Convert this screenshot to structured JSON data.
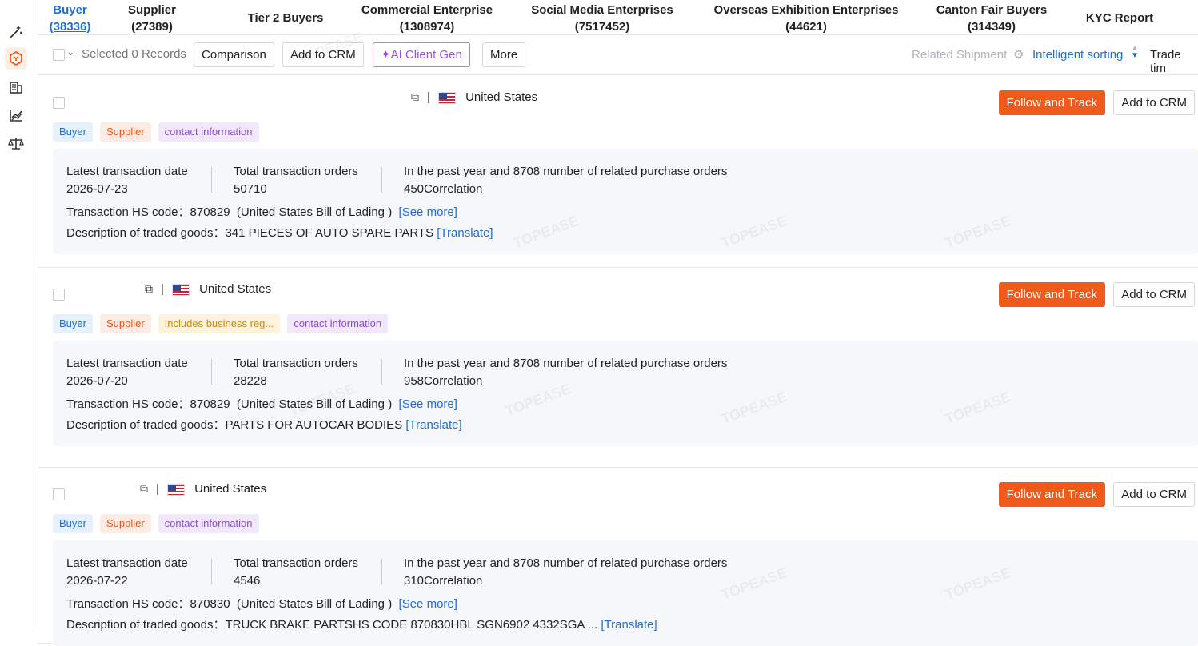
{
  "tabs": [
    {
      "label": "Buyer",
      "count": "(38336)",
      "active": true
    },
    {
      "label": "Supplier",
      "count": "(27389)"
    },
    {
      "label": "Tier 2 Buyers",
      "count": ""
    },
    {
      "label": "Commercial Enterprise",
      "count": "(1308974)"
    },
    {
      "label": "Social Media Enterprises",
      "count": "(7517452)"
    },
    {
      "label": "Overseas Exhibition Enterprises",
      "count": "(44621)"
    },
    {
      "label": "Canton Fair Buyers",
      "count": "(314349)"
    },
    {
      "label": "KYC Report",
      "count": ""
    }
  ],
  "toolbar": {
    "selected": "Selected 0 Records",
    "comparison": "Comparison",
    "add_crm": "Add to CRM",
    "ai_client_gen": "AI Client Gen",
    "more": "More",
    "related_shipment": "Related Shipment",
    "intelligent_sorting": "Intelligent sorting",
    "trade_time": "Trade tim"
  },
  "card_labels": {
    "follow": "Follow and Track",
    "add_crm": "Add to CRM",
    "latest_date": "Latest transaction date",
    "total_orders": "Total transaction orders",
    "related": "In the past year and 8708 number of related purchase orders",
    "hs_prefix": "Transaction HS code：",
    "see_more": "[See more]",
    "desc_prefix": "Description of traded goods：",
    "translate": "[Translate]"
  },
  "records": [
    {
      "country": "United States",
      "tags": [
        "Buyer",
        "Supplier",
        "contact information"
      ],
      "latest_date": "2026-07-23",
      "total_orders": "50710",
      "correlation": "450Correlation",
      "hs_code": "870829",
      "hs_source": "(United States Bill of Lading )",
      "description": "341 PIECES OF AUTO SPARE PARTS"
    },
    {
      "country": "United States",
      "tags": [
        "Buyer",
        "Supplier",
        "Includes business reg...",
        "contact information"
      ],
      "latest_date": "2026-07-20",
      "total_orders": "28228",
      "correlation": "958Correlation",
      "hs_code": "870829",
      "hs_source": "(United States Bill of Lading )",
      "description": "PARTS FOR AUTOCAR BODIES"
    },
    {
      "country": "United States",
      "tags": [
        "Buyer",
        "Supplier",
        "contact information"
      ],
      "latest_date": "2026-07-22",
      "total_orders": "4546",
      "correlation": "310Correlation",
      "hs_code": "870830",
      "hs_source": "(United States Bill of Lading )",
      "description": "TRUCK BRAKE PARTSHS CODE 870830HBL SGN6902 4332SGA ..."
    }
  ],
  "watermark": "TOPEASE",
  "colors": {
    "accent": "#1f6fd1",
    "follow": "#f05a1a",
    "ai": "#9b51e0"
  }
}
